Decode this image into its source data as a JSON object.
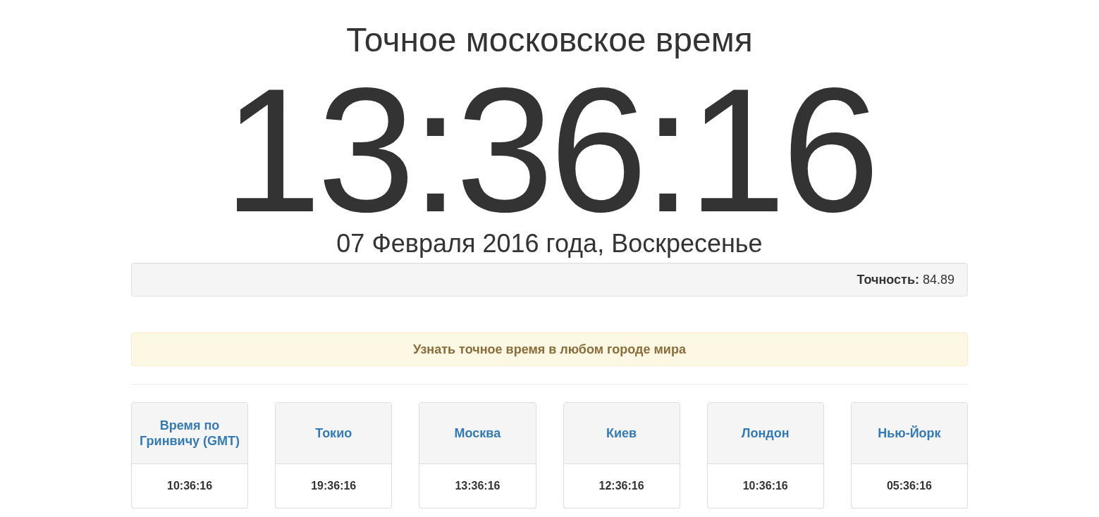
{
  "header": {
    "title": "Точное московское время",
    "clock": "13:36:16",
    "date": "07 Февраля 2016 года, Воскресенье"
  },
  "accuracy": {
    "label": "Точность:",
    "value": "84.89"
  },
  "banner": {
    "text": "Узнать точное время в любом городе мира"
  },
  "cities": [
    {
      "name": "Время по Гринвичу (GMT)",
      "time": "10:36:16"
    },
    {
      "name": "Токио",
      "time": "19:36:16"
    },
    {
      "name": "Москва",
      "time": "13:36:16"
    },
    {
      "name": "Киев",
      "time": "12:36:16"
    },
    {
      "name": "Лондон",
      "time": "10:36:16"
    },
    {
      "name": "Нью-Йорк",
      "time": "05:36:16"
    }
  ]
}
